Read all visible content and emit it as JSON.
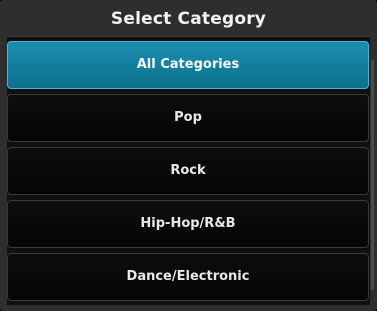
{
  "dialog": {
    "title": "Select Category",
    "items": [
      {
        "label": "All Categories",
        "selected": true
      },
      {
        "label": "Pop",
        "selected": false
      },
      {
        "label": "Rock",
        "selected": false
      },
      {
        "label": "Hip-Hop/R&B",
        "selected": false
      },
      {
        "label": "Dance/Electronic",
        "selected": false
      }
    ]
  },
  "colors": {
    "selected_background": "#1783a6",
    "panel_background": "#2e2e2e",
    "item_background": "#080808",
    "text": "#e8e8e8"
  }
}
